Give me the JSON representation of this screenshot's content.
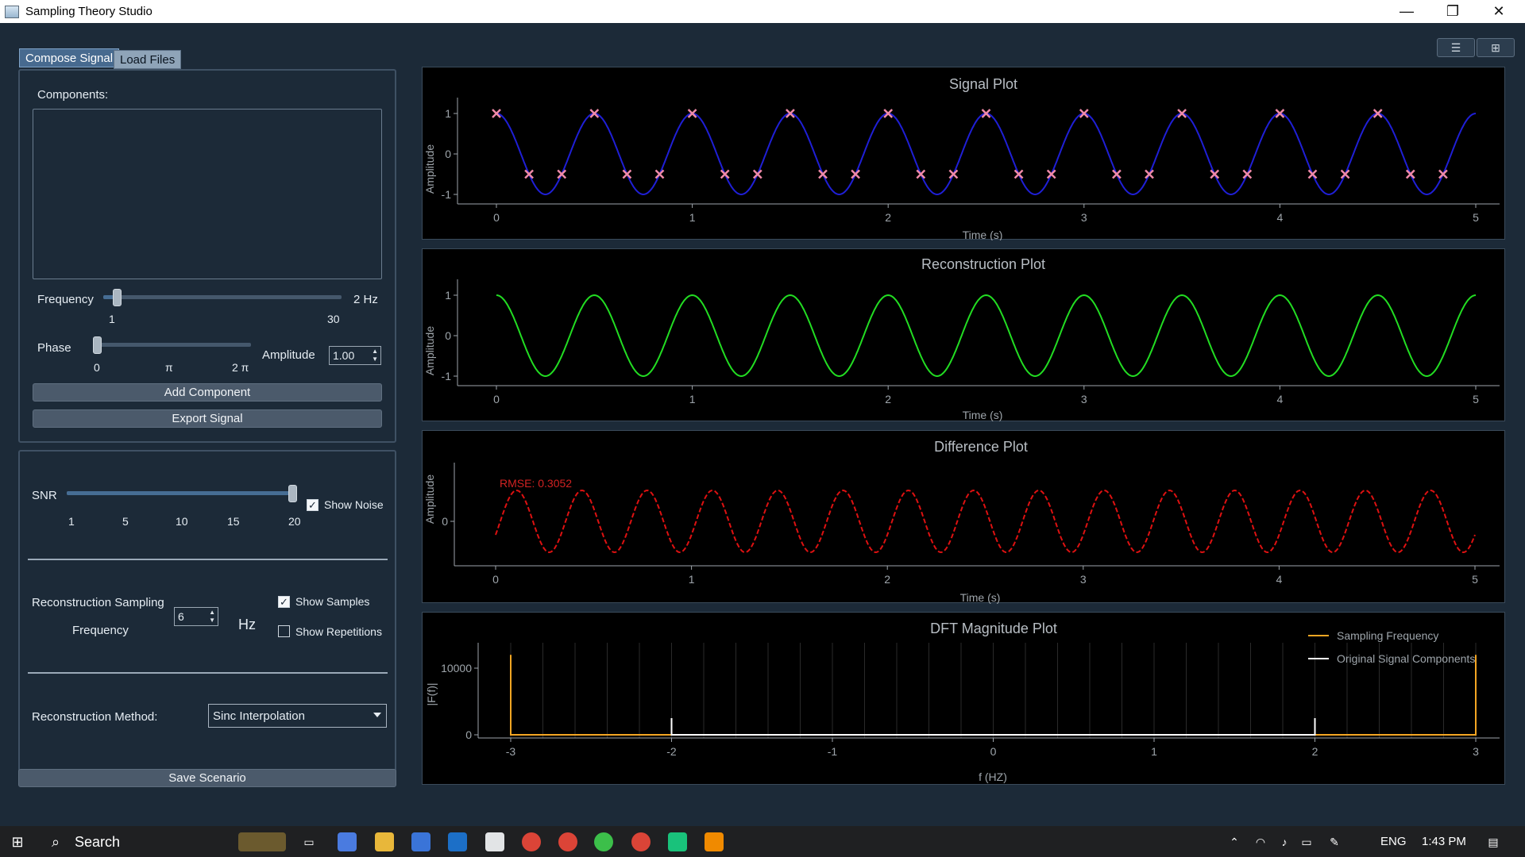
{
  "window": {
    "title": "Sampling Theory Studio",
    "controls": {
      "minimize": "—",
      "restore": "❐",
      "close": "✕"
    }
  },
  "tabs": [
    {
      "label": "Compose Signal",
      "active": true
    },
    {
      "label": "Load Files",
      "active": false
    }
  ],
  "compose": {
    "components_label": "Components:",
    "frequency": {
      "label": "Frequency",
      "value_text": "2 Hz",
      "min_label": "1",
      "max_label": "30",
      "value": 2,
      "min": 1,
      "max": 30
    },
    "phase": {
      "label": "Phase",
      "ticks": [
        "0",
        "π",
        "2 π"
      ],
      "value": 0
    },
    "amplitude": {
      "label": "Amplitude",
      "value": "1.00"
    },
    "add_button": "Add Component",
    "export_button": "Export Signal"
  },
  "noise": {
    "snr_label": "SNR",
    "snr_ticks": [
      "1",
      "5",
      "10",
      "15",
      "20"
    ],
    "snr_value": 20,
    "show_noise": {
      "label": "Show Noise",
      "checked": true
    }
  },
  "reconstruction": {
    "sampling_label_line1": "Reconstruction Sampling",
    "sampling_label_line2": "Frequency",
    "sampling_value": "6",
    "sampling_unit": "Hz",
    "show_samples": {
      "label": "Show Samples",
      "checked": true
    },
    "show_repetitions": {
      "label": "Show Repetitions",
      "checked": false
    },
    "method_label": "Reconstruction Method:",
    "method_value": "Sinc Interpolation"
  },
  "save_button": "Save Scenario",
  "view_toggles": {
    "list": "list-view-icon",
    "grid": "grid-view-icon"
  },
  "plots": {
    "signal": {
      "title": "Signal Plot",
      "xlabel": "Time (s)",
      "ylabel": "Amplitude"
    },
    "reconstruction": {
      "title": "Reconstruction Plot",
      "xlabel": "Time (s)",
      "ylabel": "Amplitude"
    },
    "difference": {
      "title": "Difference Plot",
      "xlabel": "Time (s)",
      "ylabel": "Amplitude",
      "annotation": "RMSE: 0.3052"
    },
    "dft": {
      "title": "DFT Magnitude Plot",
      "xlabel": "f (HZ)",
      "ylabel": "|F(f)|",
      "legend": [
        "Sampling Frequency",
        "Original Signal Components"
      ]
    }
  },
  "chart_data": [
    {
      "type": "line",
      "title": "Signal Plot",
      "xlabel": "Time (s)",
      "ylabel": "Amplitude",
      "xlim": [
        0,
        5
      ],
      "ylim": [
        -1,
        1
      ],
      "x_ticks": [
        "0",
        "1",
        "2",
        "3",
        "4",
        "5"
      ],
      "y_ticks": [
        "1",
        "0",
        "-1"
      ],
      "series": [
        {
          "function": "cos(2π·2·t)",
          "frequency": 2,
          "amplitude": 1,
          "color": "#1f1fd6"
        }
      ],
      "samples": {
        "rate": 6,
        "marker": "x",
        "color": "#f08aa8"
      }
    },
    {
      "type": "line",
      "title": "Reconstruction Plot",
      "xlabel": "Time (s)",
      "ylabel": "Amplitude",
      "xlim": [
        0,
        5
      ],
      "ylim": [
        -1,
        1
      ],
      "x_ticks": [
        "0",
        "1",
        "2",
        "3",
        "4",
        "5"
      ],
      "y_ticks": [
        "1",
        "0",
        "-1"
      ],
      "series": [
        {
          "function": "cos(2π·2·t)",
          "frequency": 2,
          "amplitude": 1,
          "color": "#22dd22"
        }
      ]
    },
    {
      "type": "line",
      "title": "Difference Plot",
      "xlabel": "Time (s)",
      "ylabel": "Amplitude",
      "xlim": [
        0,
        5
      ],
      "x_ticks": [
        "0",
        "1",
        "2",
        "3",
        "4",
        "5"
      ],
      "y_ticks": [
        "0"
      ],
      "series": [
        {
          "frequency": 3,
          "amplitude": 0.5,
          "style": "dashed",
          "color": "#dd1111"
        }
      ],
      "annotation": "RMSE: 0.3052"
    },
    {
      "type": "line",
      "title": "DFT Magnitude Plot",
      "xlabel": "f (HZ)",
      "ylabel": "|F(f)|",
      "xlim": [
        -3,
        3
      ],
      "ylim": [
        0,
        12000
      ],
      "x_ticks": [
        "-3",
        "-2",
        "-1",
        "0",
        "1",
        "2",
        "3"
      ],
      "y_ticks": [
        "10000",
        "0"
      ],
      "series": [
        {
          "name": "Sampling Frequency",
          "color": "#f5a623",
          "points": [
            [
              -3,
              12000
            ],
            [
              -3,
              0
            ],
            [
              3,
              0
            ],
            [
              3,
              12000
            ]
          ]
        },
        {
          "name": "Original Signal Components",
          "color": "#ffffff",
          "points": [
            [
              -2,
              2500
            ],
            [
              -2,
              0
            ],
            [
              2,
              0
            ],
            [
              2,
              2500
            ]
          ]
        }
      ]
    }
  ],
  "taskbar": {
    "search": "Search",
    "lang": "ENG",
    "time": "1:43 PM"
  }
}
